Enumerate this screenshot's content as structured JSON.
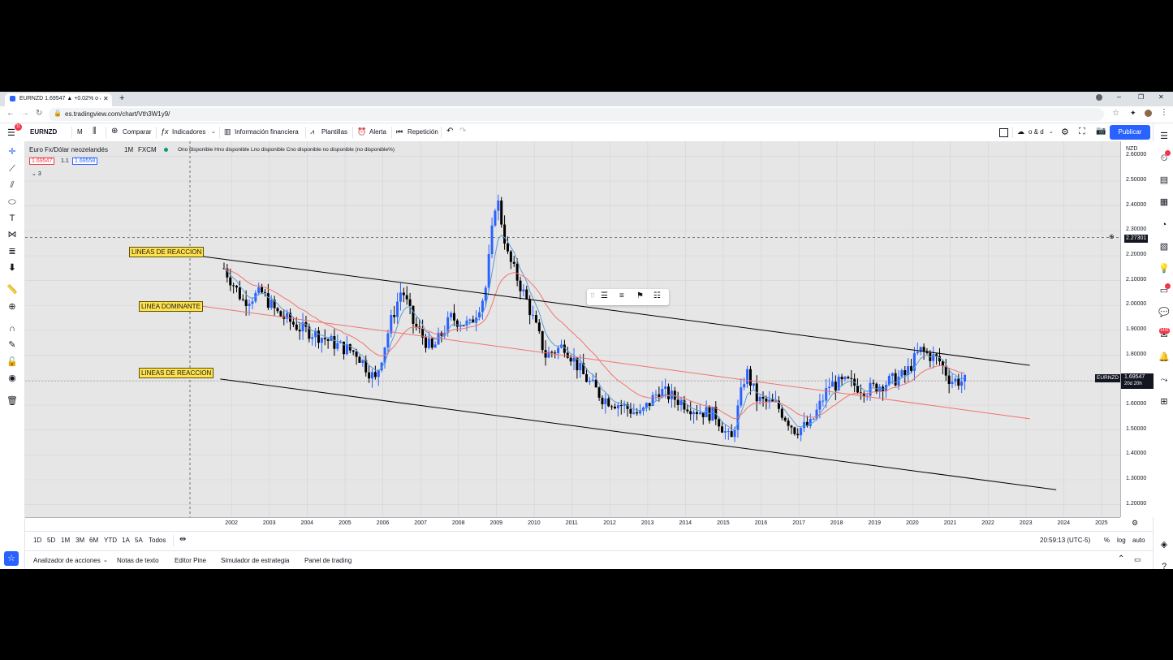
{
  "browser": {
    "tab_title": "EURNZD 1.69547 ▲ +0.02% o & ...",
    "url": "es.tradingview.com/chart/Vth3W1y9/"
  },
  "toolbar": {
    "symbol": "EURNZD",
    "interval": "M",
    "compare": "Comparar",
    "indicators": "Indicadores",
    "financials": "Información financiera",
    "templates": "Plantillas",
    "alert": "Alerta",
    "replay": "Repetición",
    "layout_label": "o & d",
    "publish": "Publicar"
  },
  "legend": {
    "name": "Euro Fx/Dólar neozelandés",
    "tf": "1M",
    "exchange": "FXCM",
    "ohlc": "Ono disponible Hno disponible Lno disponible Cno disponible no disponible (no disponible%)",
    "bid": "1.69547",
    "spread": "1.1",
    "ask": "1.69558",
    "indicators_count": "3"
  },
  "annotations": {
    "upper": "LINEAS DE REACCION",
    "middle": "LINEA DOMINANTE",
    "lower": "LINEAS DE REACCION"
  },
  "price_axis": {
    "currency": "NZD",
    "crosshair_price": "2.27301",
    "last_price": "1.69547",
    "countdown": "20d 20h",
    "symbol_tag": "EURNZD"
  },
  "time_axis": {
    "time": "20:59:13 (UTC-5)"
  },
  "ranges": [
    "1D",
    "5D",
    "1M",
    "3M",
    "6M",
    "YTD",
    "1A",
    "5A",
    "Todos"
  ],
  "scale_options": {
    "pct": "%",
    "log": "log",
    "auto": "auto"
  },
  "panels": [
    "Analizador de acciones",
    "Notas de texto",
    "Editor Pine",
    "Simulador de estrategia",
    "Panel de trading"
  ],
  "colors": {
    "bull": "#2962ff",
    "bear": "#000000",
    "ema_fast": "#5b9bd5",
    "ema_slow": "#f07470",
    "trend": "#000000"
  },
  "chart_data": {
    "type": "candlestick",
    "symbol": "EURNZD",
    "interval": "1M",
    "y_ticks": [
      "2.60000",
      "2.50000",
      "2.40000",
      "2.30000",
      "2.20000",
      "2.10000",
      "2.00000",
      "1.90000",
      "1.80000",
      "1.70000",
      "1.60000",
      "1.50000",
      "1.40000",
      "1.30000",
      "1.20000"
    ],
    "x_ticks": [
      "2002",
      "2003",
      "2004",
      "2005",
      "2006",
      "2007",
      "2008",
      "2009",
      "2010",
      "2011",
      "2012",
      "2013",
      "2014",
      "2015",
      "2016",
      "2017",
      "2018",
      "2019",
      "2020",
      "2021",
      "2022",
      "2023",
      "2024",
      "2025"
    ],
    "ylim": [
      1.15,
      2.66
    ],
    "yearly_closes": [
      {
        "x": 2001.8,
        "y": 2.15
      },
      {
        "x": 2002.3,
        "y": 2.02
      },
      {
        "x": 2002.8,
        "y": 2.05
      },
      {
        "x": 2003.2,
        "y": 1.97
      },
      {
        "x": 2003.8,
        "y": 1.91
      },
      {
        "x": 2004.3,
        "y": 1.88
      },
      {
        "x": 2004.8,
        "y": 1.84
      },
      {
        "x": 2005.3,
        "y": 1.81
      },
      {
        "x": 2005.8,
        "y": 1.7
      },
      {
        "x": 2006.2,
        "y": 1.93
      },
      {
        "x": 2006.5,
        "y": 2.07
      },
      {
        "x": 2006.8,
        "y": 1.93
      },
      {
        "x": 2007.3,
        "y": 1.82
      },
      {
        "x": 2007.8,
        "y": 1.95
      },
      {
        "x": 2008.3,
        "y": 1.92
      },
      {
        "x": 2008.7,
        "y": 2.05
      },
      {
        "x": 2009.0,
        "y": 2.45
      },
      {
        "x": 2009.3,
        "y": 2.2
      },
      {
        "x": 2009.8,
        "y": 2.02
      },
      {
        "x": 2010.3,
        "y": 1.8
      },
      {
        "x": 2010.8,
        "y": 1.84
      },
      {
        "x": 2011.3,
        "y": 1.72
      },
      {
        "x": 2011.8,
        "y": 1.63
      },
      {
        "x": 2012.3,
        "y": 1.6
      },
      {
        "x": 2012.8,
        "y": 1.56
      },
      {
        "x": 2013.3,
        "y": 1.66
      },
      {
        "x": 2013.8,
        "y": 1.62
      },
      {
        "x": 2014.3,
        "y": 1.58
      },
      {
        "x": 2014.8,
        "y": 1.56
      },
      {
        "x": 2015.2,
        "y": 1.45
      },
      {
        "x": 2015.6,
        "y": 1.74
      },
      {
        "x": 2015.9,
        "y": 1.62
      },
      {
        "x": 2016.4,
        "y": 1.6
      },
      {
        "x": 2016.9,
        "y": 1.5
      },
      {
        "x": 2017.3,
        "y": 1.52
      },
      {
        "x": 2017.8,
        "y": 1.68
      },
      {
        "x": 2018.3,
        "y": 1.69
      },
      {
        "x": 2018.8,
        "y": 1.66
      },
      {
        "x": 2019.3,
        "y": 1.69
      },
      {
        "x": 2019.8,
        "y": 1.72
      },
      {
        "x": 2020.2,
        "y": 1.82
      },
      {
        "x": 2020.7,
        "y": 1.78
      },
      {
        "x": 2021.0,
        "y": 1.7
      },
      {
        "x": 2021.4,
        "y": 1.69547
      }
    ]
  }
}
